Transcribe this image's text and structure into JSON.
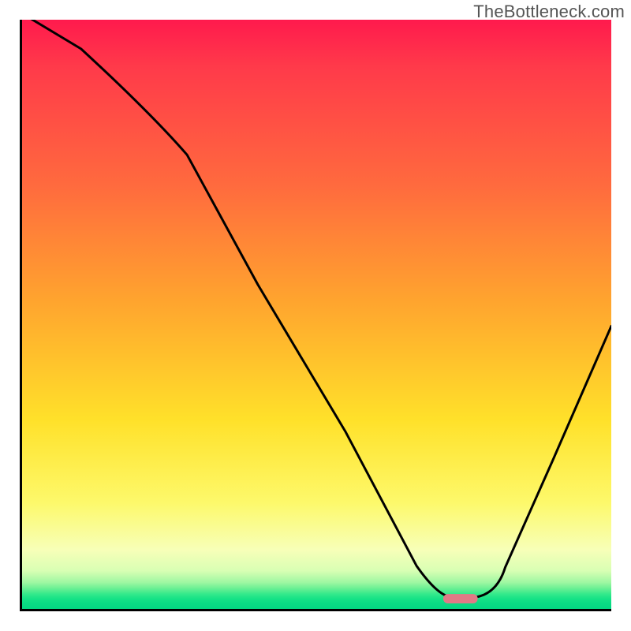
{
  "watermark": "TheBottleneck.com",
  "chart_data": {
    "type": "line",
    "title": "",
    "xlabel": "",
    "ylabel": "",
    "xlim": [
      0,
      100
    ],
    "ylim": [
      0,
      100
    ],
    "grid": false,
    "legend": false,
    "annotations": [],
    "gradient_stops": [
      {
        "pct": 0,
        "color": "#ff1a4d"
      },
      {
        "pct": 28,
        "color": "#ff6a3e"
      },
      {
        "pct": 48,
        "color": "#ffa52e"
      },
      {
        "pct": 68,
        "color": "#ffe12a"
      },
      {
        "pct": 82,
        "color": "#fdf96b"
      },
      {
        "pct": 92,
        "color": "#f7ffb8"
      },
      {
        "pct": 96,
        "color": "#7af59d"
      },
      {
        "pct": 100,
        "color": "#04d782"
      }
    ],
    "series": [
      {
        "name": "bottleneck-curve",
        "x": [
          0,
          10,
          22,
          28,
          40,
          55,
          67,
          72,
          76,
          82,
          90,
          100
        ],
        "values": [
          101,
          95,
          84,
          77,
          55,
          30,
          7,
          2,
          2,
          7,
          25,
          48
        ]
      }
    ],
    "optimal_marker": {
      "x_start": 72,
      "x_end": 77,
      "color": "#e07a86"
    }
  }
}
